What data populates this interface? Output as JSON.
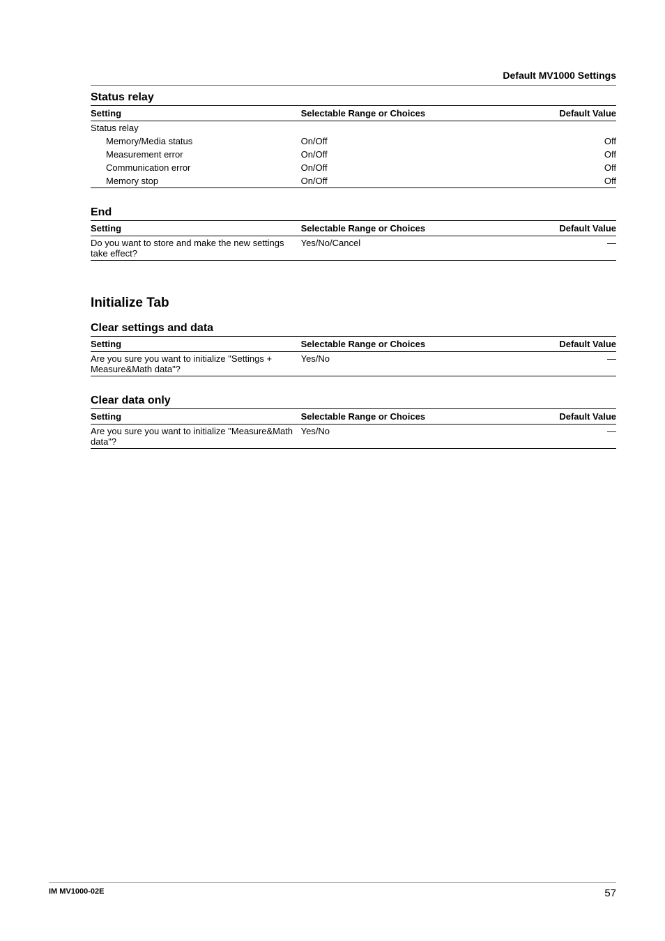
{
  "header": {
    "title": "Default MV1000 Settings"
  },
  "tables": {
    "status_relay": {
      "title": "Status relay",
      "cols": {
        "setting": "Setting",
        "choices": "Selectable Range or Choices",
        "default": "Default Value"
      },
      "rows": [
        {
          "setting": "Status relay",
          "choices": "",
          "default": "",
          "indent": false
        },
        {
          "setting": "Memory/Media status",
          "choices": "On/Off",
          "default": "Off",
          "indent": true
        },
        {
          "setting": "Measurement error",
          "choices": "On/Off",
          "default": "Off",
          "indent": true
        },
        {
          "setting": "Communication error",
          "choices": "On/Off",
          "default": "Off",
          "indent": true
        },
        {
          "setting": "Memory stop",
          "choices": "On/Off",
          "default": "Off",
          "indent": true
        }
      ]
    },
    "end": {
      "title": "End",
      "cols": {
        "setting": "Setting",
        "choices": "Selectable Range or Choices",
        "default": "Default Value"
      },
      "rows": [
        {
          "setting": "Do you want to store and make the new settings take effect?",
          "choices": "Yes/No/Cancel",
          "default": "—",
          "indent": false
        }
      ]
    },
    "clear_settings": {
      "title": "Clear settings and data",
      "cols": {
        "setting": "Setting",
        "choices": "Selectable Range or Choices",
        "default": "Default Value"
      },
      "rows": [
        {
          "setting": "Are you sure you want to initialize \"Settings + Measure&Math data\"?",
          "choices": "Yes/No",
          "default": "—",
          "indent": false
        }
      ]
    },
    "clear_data": {
      "title": "Clear data only",
      "cols": {
        "setting": "Setting",
        "choices": "Selectable Range or Choices",
        "default": "Default Value"
      },
      "rows": [
        {
          "setting": "Are you sure you want to initialize \"Measure&Math data\"?",
          "choices": "Yes/No",
          "default": "—",
          "indent": false
        }
      ]
    }
  },
  "tab": {
    "title": "Initialize Tab"
  },
  "footer": {
    "docid": "IM MV1000-02E",
    "page": "57"
  }
}
